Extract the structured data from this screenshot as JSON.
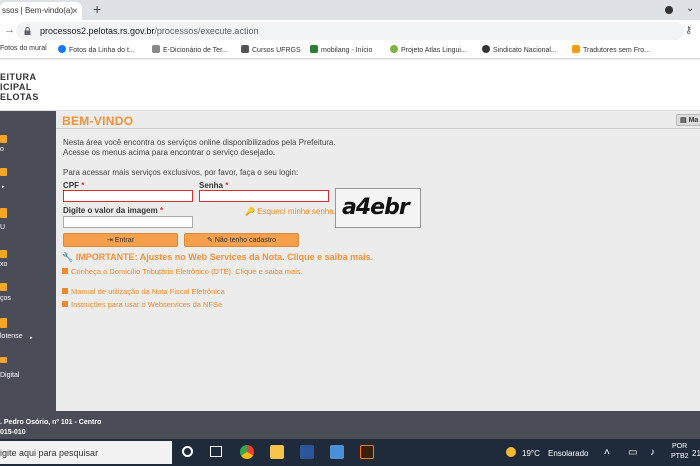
{
  "browser": {
    "tab_title": "ssos | Bem-vindo(a)",
    "tab_close": "×",
    "new_tab": "+",
    "url_host": "processos2.pelotas.rs.gov.br",
    "url_path": "/processos/execute.action",
    "bookmarks": [
      {
        "label": "Fotos do mural",
        "color": "#c0392b"
      },
      {
        "label": "Fotos da Linha do t...",
        "color": "#1877f2"
      },
      {
        "label": "E-Dicionário de Ter...",
        "color": "#666666"
      },
      {
        "label": "Cursos UFRGS",
        "color": "#444444"
      },
      {
        "label": "mobilang - Início",
        "color": "#2e7d32"
      },
      {
        "label": "Projeto Atlas Lingui...",
        "color": "#7cb342"
      },
      {
        "label": "Sindicato Nacional...",
        "color": "#333333"
      },
      {
        "label": "Tradutores sem Fro...",
        "color": "#f39c12"
      }
    ]
  },
  "header": {
    "logo_line1": "EITURA",
    "logo_line2": "ICIPAL",
    "logo_line3": "ELOTAS"
  },
  "sidebar": {
    "items": [
      {
        "label": "o",
        "arrow": ""
      },
      {
        "label": "",
        "arrow": "▸"
      },
      {
        "label": "U",
        "arrow": ""
      },
      {
        "label": "xo",
        "arrow": ""
      },
      {
        "label": "ços",
        "arrow": ""
      },
      {
        "label": "lotense",
        "arrow": "▸"
      },
      {
        "label": "Digital",
        "arrow": ""
      }
    ]
  },
  "main": {
    "title": "BEM-VINDO",
    "map_button": "Ma",
    "intro_1": "Nesta área você encontra os serviços online disponibilizados pela Prefeitura.",
    "intro_2": "Acesse os menus acima para encontrar o serviço desejado.",
    "login_prompt": "Para acessar mais serviços exclusivos, por favor, faça o seu login:",
    "cpf_label": "CPF",
    "senha_label": "Senha",
    "captcha_label": "Digite o valor da imagem",
    "required_mark": "*",
    "forgot_password": "Esqueci minha senha.",
    "captcha_text": "a4ebr",
    "enter_button": "Entrar",
    "no_account_button": "Não tenho cadastro",
    "important": "IMPORTANTE: Ajustes no Web Services da Nota. Clique e saiba mais.",
    "links": [
      "Conheça o Domicílio Tributário Eletrônico (DTE). Clique e saiba mais.",
      "Manual de utilização da Nota Fiscal Eletrônica",
      "Instruções para usar o Webservices da NFSe"
    ]
  },
  "footer": {
    "address": ". Pedro Osório, nº 101 - Centro",
    "zip": "015-010"
  },
  "taskbar": {
    "search_placeholder": "igite aqui para pesquisar",
    "weather_temp": "19°C",
    "weather_text": "Ensolarado",
    "lang_1": "POR",
    "lang_2": "PTB2",
    "time": "21"
  }
}
